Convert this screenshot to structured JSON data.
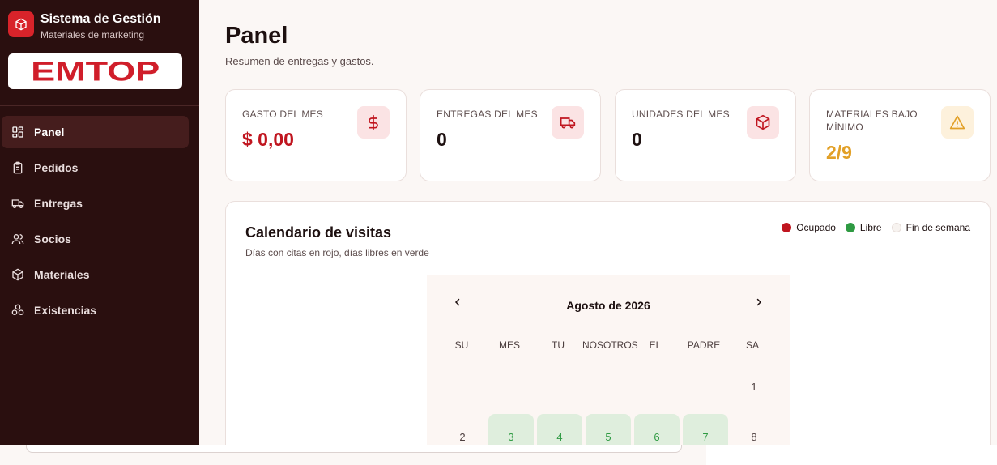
{
  "brand": {
    "title": "Sistema de Gestión",
    "subtitle": "Materiales de marketing",
    "logo_text": "EMTOP"
  },
  "sidebar": {
    "items": [
      {
        "label": "Panel",
        "icon": "grid-icon",
        "active": true
      },
      {
        "label": "Pedidos",
        "icon": "clipboard-icon"
      },
      {
        "label": "Entregas",
        "icon": "truck-icon"
      },
      {
        "label": "Socios",
        "icon": "users-icon"
      },
      {
        "label": "Materiales",
        "icon": "box-icon"
      },
      {
        "label": "Existencias",
        "icon": "boxes-icon"
      }
    ]
  },
  "page": {
    "title": "Panel",
    "subtitle": "Resumen de entregas y gastos."
  },
  "stats": [
    {
      "label": "GASTO DEL MES",
      "value": "$ 0,00",
      "icon": "dollar-icon",
      "value_color": "#c0151f"
    },
    {
      "label": "ENTREGAS DEL MES",
      "value": "0",
      "icon": "truck-icon",
      "value_color": "#1d1010"
    },
    {
      "label": "UNIDADES DEL MES",
      "value": "0",
      "icon": "box-icon",
      "value_color": "#1d1010"
    },
    {
      "label": "MATERIALES BAJO MÍNIMO",
      "value": "2/9",
      "icon": "warning-icon",
      "value_color": "#e2a027"
    }
  ],
  "calendar": {
    "title": "Calendario de visitas",
    "subtitle": "Días con citas en rojo, días libres en verde",
    "legend": [
      {
        "label": "Ocupado",
        "color": "#c0151f"
      },
      {
        "label": "Libre",
        "color": "#2e9a42"
      },
      {
        "label": "Fin de semana",
        "color": "#f3eeea"
      }
    ],
    "month": "Agosto de 2026",
    "weekdays": [
      "SU",
      "MES",
      "TU",
      "NOSOTROS",
      "EL",
      "PADRE",
      "SA"
    ],
    "weeks": [
      [
        "",
        "",
        "",
        "",
        "",
        "",
        "1"
      ],
      [
        "2",
        "3",
        "4",
        "5",
        "6",
        "7",
        "8"
      ]
    ],
    "free_days": [
      "3",
      "4",
      "5",
      "6",
      "7"
    ]
  },
  "colors": {
    "sidebar_bg": "#2a0f0f",
    "accent": "#d8232a",
    "main_bg": "#fbf7f5"
  }
}
